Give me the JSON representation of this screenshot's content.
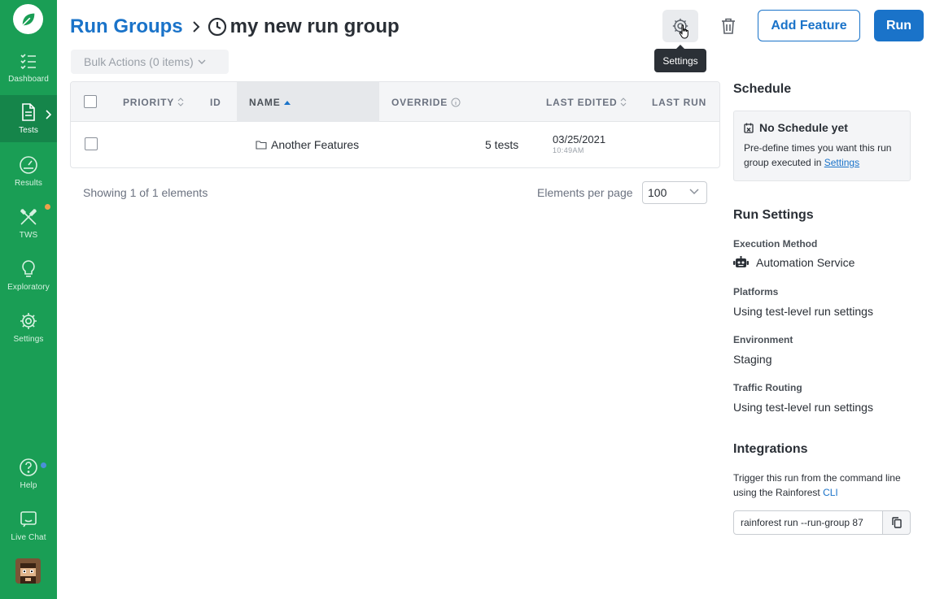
{
  "sidebar": {
    "items": [
      {
        "label": "Dashboard"
      },
      {
        "label": "Tests"
      },
      {
        "label": "Results"
      },
      {
        "label": "TWS"
      },
      {
        "label": "Exploratory"
      },
      {
        "label": "Settings"
      },
      {
        "label": "Help"
      },
      {
        "label": "Live Chat"
      }
    ],
    "active_item": "Tests",
    "colors": {
      "background": "#1a9e55",
      "active": "#15854a",
      "tws_dot": "#f0a04b",
      "help_dot": "#4a90d9"
    }
  },
  "header": {
    "breadcrumb_link": "Run Groups",
    "current_title": "my new run group",
    "tooltip": "Settings",
    "add_feature_label": "Add Feature",
    "run_label": "Run"
  },
  "bulk_actions": {
    "label": "Bulk Actions (0 items)"
  },
  "table": {
    "columns": [
      "PRIORITY",
      "ID",
      "NAME",
      "OVERRIDE",
      "LAST EDITED",
      "LAST RUN"
    ],
    "sorted_column": "NAME",
    "rows": [
      {
        "priority": "",
        "id": "",
        "name": "Another Features",
        "override": "5 tests",
        "last_edited_date": "03/25/2021",
        "last_edited_time": "10:49AM",
        "last_run": ""
      }
    ]
  },
  "pagination": {
    "showing": "Showing 1 of 1 elements",
    "per_page_label": "Elements per page",
    "per_page_value": "100"
  },
  "schedule": {
    "heading": "Schedule",
    "title": "No Schedule yet",
    "text": "Pre-define times you want this run group executed in",
    "link": "Settings"
  },
  "run_settings": {
    "heading": "Run Settings",
    "execution_method_label": "Execution Method",
    "execution_method_value": "Automation Service",
    "platforms_label": "Platforms",
    "platforms_value": "Using test-level run settings",
    "environment_label": "Environment",
    "environment_value": "Staging",
    "traffic_label": "Traffic Routing",
    "traffic_value": "Using test-level run settings"
  },
  "integrations": {
    "heading": "Integrations",
    "text": "Trigger this run from the command line using the Rainforest",
    "link": "CLI",
    "command": "rainforest run --run-group 87"
  },
  "colors": {
    "primary": "#1a73c9",
    "text": "#2a2f36"
  }
}
